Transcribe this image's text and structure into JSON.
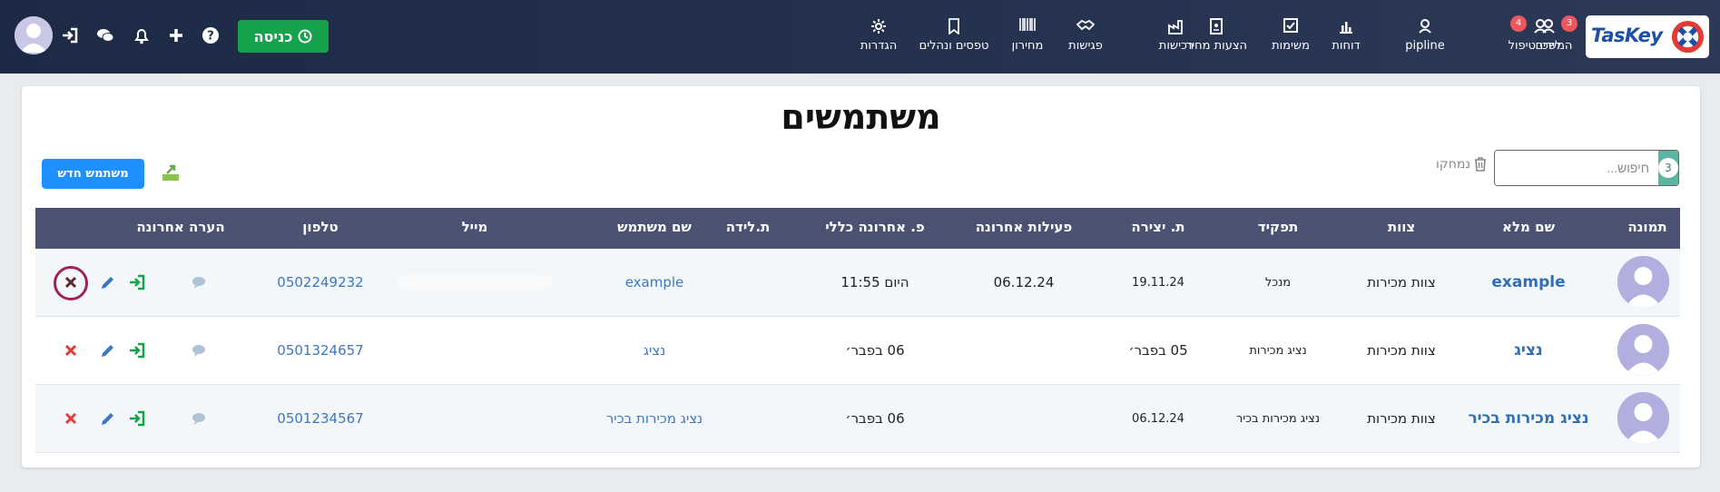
{
  "brand": {
    "logo_text": "TasKey"
  },
  "nav": [
    {
      "id": "leads",
      "label": "לידים",
      "icon": "user-icon",
      "badge": "3"
    },
    {
      "id": "followups",
      "label": "המשכי טיפול",
      "icon": "user-icon",
      "badge": "4"
    },
    {
      "id": "pipeline",
      "label": "pipline",
      "icon": "user-icon"
    },
    {
      "id": "reports",
      "label": "דוחות",
      "icon": "bar-chart-icon"
    },
    {
      "id": "tasks",
      "label": "משימות",
      "icon": "checkbox-icon"
    },
    {
      "id": "quotes",
      "label": "הצעות מחיר",
      "icon": "document-icon"
    },
    {
      "id": "purchases",
      "label": "רכישות",
      "icon": "factory-icon"
    },
    {
      "id": "meetings",
      "label": "פגישות",
      "icon": "handshake-icon"
    },
    {
      "id": "pricelist",
      "label": "מחירון",
      "icon": "barcode-icon"
    },
    {
      "id": "forms",
      "label": "טפסים ונהלים",
      "icon": "book-icon"
    },
    {
      "id": "settings",
      "label": "הגדרות",
      "icon": "gear-icon"
    }
  ],
  "header_actions": {
    "entry_label": "כניסה"
  },
  "page": {
    "title": "משתמשים",
    "search_placeholder": "חיפוש...",
    "count": "3",
    "deleted_label": "נמחקו",
    "new_user_label": "משתמש חדש"
  },
  "table": {
    "columns": {
      "photo": "תמונה",
      "full_name": "שם מלא",
      "team": "צוות",
      "role": "תפקיד",
      "created": "ת. יצירה",
      "last_activity": "פעילות אחרונה",
      "last_general": "פ. אחרונה כללי",
      "birthdate": "ת.לידה",
      "username": "שם משתמש",
      "email": "מייל",
      "phone": "טלפון",
      "last_note": "הערה אחרונה"
    },
    "rows": [
      {
        "full_name": "example",
        "team": "צוות מכירות",
        "role": "מנכל",
        "created": "19.11.24",
        "last_activity": "06.12.24",
        "last_general": "היום 11:55",
        "birthdate": "",
        "username": "example",
        "email": "",
        "phone": "0502249232"
      },
      {
        "full_name": "נציג",
        "team": "צוות מכירות",
        "role": "נציג מכירות",
        "created": "05 בפבר׳",
        "last_activity": "",
        "last_general": "06 בפבר׳",
        "birthdate": "",
        "username": "נציג",
        "email": "",
        "phone": "0501324657"
      },
      {
        "full_name": "נציג מכירות בכיר",
        "team": "צוות מכירות",
        "role": "נציג מכירות בכיר",
        "created": "06.12.24",
        "last_activity": "",
        "last_general": "06 בפבר׳",
        "birthdate": "",
        "username": "נציג מכירות בכיר",
        "email": "",
        "phone": "0501234567"
      }
    ]
  },
  "colors": {
    "accent_green": "#14a34a",
    "header_bg": "#4c5273",
    "link": "#3c78c2",
    "delete_highlight": "#a0225a"
  }
}
